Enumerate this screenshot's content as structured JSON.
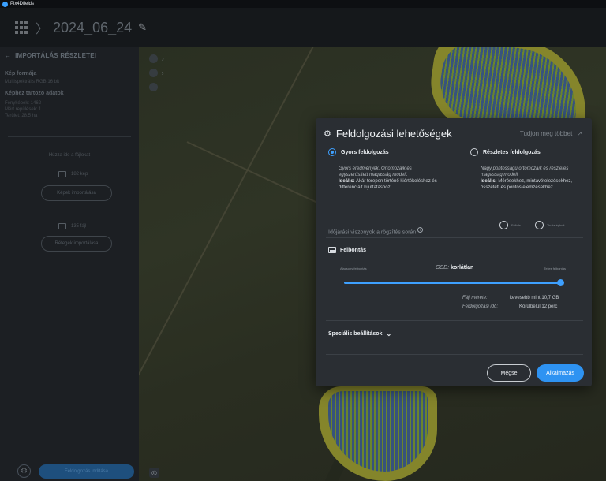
{
  "app": {
    "title": "Pix4Dfields"
  },
  "project": {
    "name": "2024_06_24"
  },
  "sidebar": {
    "header": "IMPORTÁLÁS RÉSZLETEI",
    "image_format_title": "Kép formája",
    "image_format_value": "Multispektrális RGB 16 bit",
    "image_data_title": "Képhez tartozó adatok",
    "image_data_lines": [
      "Fényképek: 1462",
      "Mért repülések: 1",
      "Terület: 28,5 ha"
    ],
    "drag_hint": "Húzza ide a fájlokat",
    "images_count": "182 kép",
    "import_images": "Képek importálása",
    "layers_count": "135 fájl",
    "import_layers": "Rétegek importálása",
    "process_button": "Feldolgozás indítása"
  },
  "dialog": {
    "title": "Feldolgozási lehetőségek",
    "learn_more": "Tudjon meg többet",
    "fast": {
      "label": "Gyors feldolgozás",
      "desc_italic": "Gyors eredmények. Ortomozaik és egyszerűsített magasság modell.",
      "ideal_label": "Ideális:",
      "ideal_text": "Akár terepen történő kiértékeléshez és differenciált kijuttatáshoz"
    },
    "detailed": {
      "label": "Részletes feldolgozás",
      "desc_italic": "Nagy pontosságú ortomozaik és részletes magasság modell.",
      "ideal_label": "Ideális:",
      "ideal_text": "Mérésekhez, mintavételezésekhez, összetett és pontos elemzésekhez."
    },
    "weather": {
      "label": "Időjárási viszonyok a rögzítés során",
      "cloudy": "Felhős",
      "clear": "Tiszta égbolt"
    },
    "resolution": {
      "title": "Felbontás",
      "low": "Alacsony felbontás",
      "gsd_key": "GSD:",
      "gsd_value": "korlátlan",
      "full": "Teljes felbontás",
      "level": 1.0,
      "file_size_key": "Fájl mérete:",
      "file_size_value": "kevesebb mint 10,7 GB",
      "time_key": "Feldolgozási idő:",
      "time_value": "Körülbelül 12 perc"
    },
    "special_settings": "Speciális beállítások",
    "cancel": "Mégse",
    "apply": "Alkalmazás"
  },
  "colors": {
    "accent": "#3ea0ff",
    "dialog_bg": "#2a2e33"
  },
  "icons": [
    "app-logo-icon",
    "grid-icon",
    "pencil-icon",
    "back-arrow-icon",
    "gear-icon",
    "external-link-icon",
    "info-icon",
    "resolution-icon",
    "chevron-down-icon"
  ]
}
